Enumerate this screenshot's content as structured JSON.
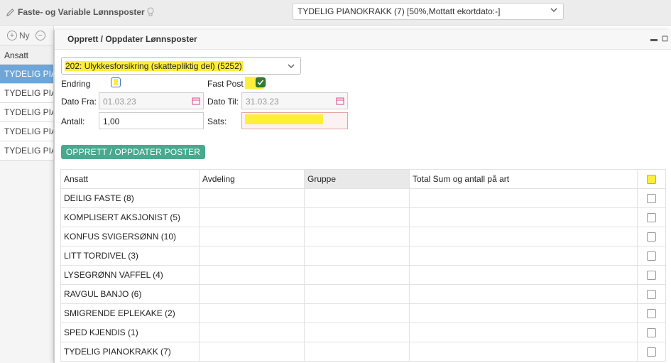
{
  "topbar": {
    "title": "Faste- og Variable Lønnsposter",
    "employee_select": "TYDELIG PIANOKRAKK (7) [50%,Mottatt ekortdato:-]"
  },
  "leftpanel": {
    "new_label": "Ny",
    "header": "Ansatt",
    "rows": [
      "TYDELIG PIANOKRAKK",
      "TYDELIG PIANOKRAKK",
      "TYDELIG PIANOKRAKK",
      "TYDELIG PIANOKRAKK",
      "TYDELIG PIANOKRAKK"
    ]
  },
  "dialog": {
    "title": "Opprett / Oppdater Lønnsposter",
    "art_select": "202: Ulykkesforsikring (skattepliktig del) (5252)",
    "endring_label": "Endring",
    "endring_checked": false,
    "fastpost_label": "Fast Post",
    "fastpost_checked": true,
    "dato_fra_label": "Dato Fra:",
    "dato_fra_value": "01.03.23",
    "dato_til_label": "Dato Til:",
    "dato_til_value": "31.03.23",
    "antall_label": "Antall:",
    "antall_value": "1,00",
    "sats_label": "Sats:",
    "sats_value": "",
    "submit_label": "OPPRETT / OPPDATER POSTER"
  },
  "table": {
    "columns": [
      "Ansatt",
      "Avdeling",
      "Gruppe",
      "Total Sum og antall på art"
    ],
    "rows": [
      {
        "ansatt": "DEILIG FASTE (8)",
        "avdeling": "",
        "gruppe": "",
        "total": ""
      },
      {
        "ansatt": "KOMPLISERT AKSJONIST (5)",
        "avdeling": "",
        "gruppe": "",
        "total": ""
      },
      {
        "ansatt": "KONFUS SVIGERSØNN (10)",
        "avdeling": "",
        "gruppe": "",
        "total": ""
      },
      {
        "ansatt": "LITT TORDIVEL (3)",
        "avdeling": "",
        "gruppe": "",
        "total": ""
      },
      {
        "ansatt": "LYSEGRØNN VAFFEL (4)",
        "avdeling": "",
        "gruppe": "",
        "total": ""
      },
      {
        "ansatt": "RAVGUL BANJO (6)",
        "avdeling": "",
        "gruppe": "",
        "total": ""
      },
      {
        "ansatt": "SMIGRENDE EPLEKAKE (2)",
        "avdeling": "",
        "gruppe": "",
        "total": ""
      },
      {
        "ansatt": "SPED KJENDIS (1)",
        "avdeling": "",
        "gruppe": "",
        "total": ""
      },
      {
        "ansatt": "TYDELIG PIANOKRAKK (7)",
        "avdeling": "",
        "gruppe": "",
        "total": ""
      }
    ]
  },
  "colors": {
    "highlight": "#ffef3a",
    "button": "#49a98f",
    "selected_row": "#6fa6d8",
    "check_green": "#2e7d32"
  }
}
